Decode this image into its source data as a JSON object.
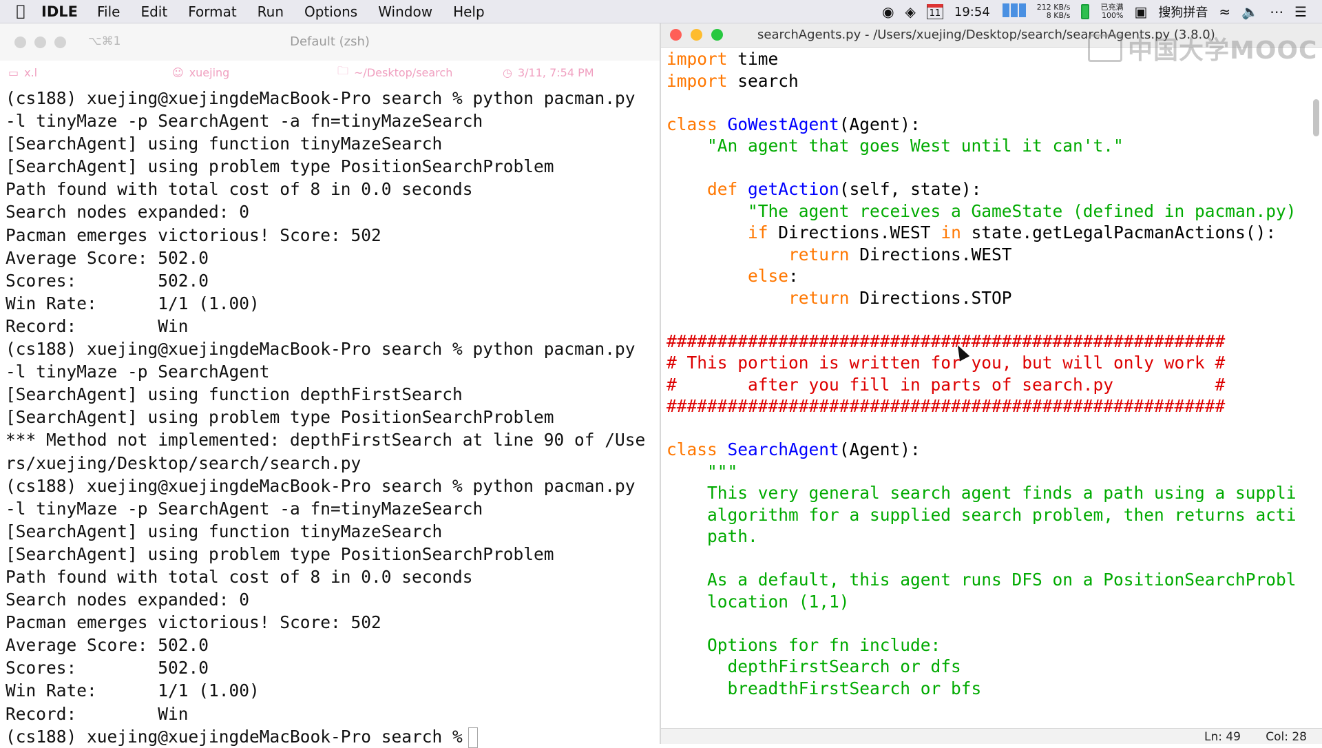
{
  "menubar": {
    "app_name": "IDLE",
    "menus": [
      "File",
      "Edit",
      "Format",
      "Run",
      "Options",
      "Window",
      "Help"
    ],
    "date_badge": "11",
    "clock": "19:54",
    "net_up": "212 KB/s",
    "net_down": "8 KB/s",
    "battery_status": "已充满",
    "battery_percent": "100%",
    "input_method": "搜狗拼音",
    "icons": [
      "apple-icon",
      "app-icon-1",
      "app-icon-2",
      "calendar-icon",
      "cpu-icon",
      "battery-icon",
      "sogou-icon",
      "wifi-icon",
      "volume-icon",
      "more-icon",
      "list-icon"
    ]
  },
  "terminal": {
    "shortcut": "⌥⌘1",
    "title": "Default (zsh)",
    "info": {
      "shell": "x.l",
      "user": "xuejing",
      "path": "~/Desktop/search",
      "time": "3/11, 7:54 PM"
    },
    "lines": [
      "(cs188) xuejing@xuejingdeMacBook-Pro search % python pacman.py",
      "-l tinyMaze -p SearchAgent -a fn=tinyMazeSearch",
      "[SearchAgent] using function tinyMazeSearch",
      "[SearchAgent] using problem type PositionSearchProblem",
      "Path found with total cost of 8 in 0.0 seconds",
      "Search nodes expanded: 0",
      "Pacman emerges victorious! Score: 502",
      "Average Score: 502.0",
      "Scores:        502.0",
      "Win Rate:      1/1 (1.00)",
      "Record:        Win",
      "(cs188) xuejing@xuejingdeMacBook-Pro search % python pacman.py",
      "-l tinyMaze -p SearchAgent",
      "[SearchAgent] using function depthFirstSearch",
      "[SearchAgent] using problem type PositionSearchProblem",
      "*** Method not implemented: depthFirstSearch at line 90 of /Use",
      "rs/xuejing/Desktop/search/search.py",
      "(cs188) xuejing@xuejingdeMacBook-Pro search % python pacman.py",
      "-l tinyMaze -p SearchAgent -a fn=tinyMazeSearch",
      "[SearchAgent] using function tinyMazeSearch",
      "[SearchAgent] using problem type PositionSearchProblem",
      "Path found with total cost of 8 in 0.0 seconds",
      "Search nodes expanded: 0",
      "Pacman emerges victorious! Score: 502",
      "Average Score: 502.0",
      "Scores:        502.0",
      "Win Rate:      1/1 (1.00)",
      "Record:        Win"
    ],
    "prompt": "(cs188) xuejing@xuejingdeMacBook-Pro search %"
  },
  "editor": {
    "title": "searchAgents.py - /Users/xuejing/Desktop/search/searchAgents.py (3.8.0)",
    "code_lines": [
      [
        [
          "kw",
          "import"
        ],
        [
          "",
          "time"
        ]
      ],
      [
        [
          "kw",
          "import"
        ],
        [
          "",
          "search"
        ]
      ],
      [],
      [
        [
          "kw",
          "class"
        ],
        [
          "df",
          "GoWestAgent"
        ],
        [
          "",
          "(Agent):"
        ]
      ],
      [
        [
          "",
          "    "
        ],
        [
          "st",
          "\"An agent that goes West until it can't.\""
        ]
      ],
      [],
      [
        [
          "",
          "    "
        ],
        [
          "kw",
          "def"
        ],
        [
          "df",
          "getAction"
        ],
        [
          "",
          "(self, state):"
        ]
      ],
      [
        [
          "",
          "        "
        ],
        [
          "st",
          "\"The agent receives a GameState (defined in pacman.py)"
        ]
      ],
      [
        [
          "",
          "        "
        ],
        [
          "kw",
          "if"
        ],
        [
          "",
          "Directions.WEST "
        ],
        [
          "kw",
          "in"
        ],
        [
          "",
          "state.getLegalPacmanActions():"
        ]
      ],
      [
        [
          "",
          "            "
        ],
        [
          "kw",
          "return"
        ],
        [
          "",
          "Directions.WEST"
        ]
      ],
      [
        [
          "",
          "        "
        ],
        [
          "kw",
          "else"
        ],
        [
          "",
          ":"
        ]
      ],
      [
        [
          "",
          "            "
        ],
        [
          "kw",
          "return"
        ],
        [
          "",
          "Directions.STOP"
        ]
      ],
      [],
      [
        [
          "cm",
          "#######################################################"
        ]
      ],
      [
        [
          "cm",
          "# This portion is written for you, but will only work #"
        ]
      ],
      [
        [
          "cm",
          "#       after you fill in parts of search.py          #"
        ]
      ],
      [
        [
          "cm",
          "#######################################################"
        ]
      ],
      [],
      [
        [
          "kw",
          "class"
        ],
        [
          "df",
          "SearchAgent"
        ],
        [
          "",
          "(Agent):"
        ]
      ],
      [
        [
          "",
          "    "
        ],
        [
          "st",
          "\"\"\""
        ]
      ],
      [
        [
          "",
          "    "
        ],
        [
          "st",
          "This very general search agent finds a path using a suppli"
        ]
      ],
      [
        [
          "",
          "    "
        ],
        [
          "st",
          "algorithm for a supplied search problem, then returns acti"
        ]
      ],
      [
        [
          "",
          "    "
        ],
        [
          "st",
          "path."
        ]
      ],
      [],
      [
        [
          "",
          "    "
        ],
        [
          "st",
          "As a default, this agent runs DFS on a PositionSearchProbl"
        ]
      ],
      [
        [
          "",
          "    "
        ],
        [
          "st",
          "location (1,1)"
        ]
      ],
      [],
      [
        [
          "",
          "    "
        ],
        [
          "st",
          "Options for fn include:"
        ]
      ],
      [
        [
          "",
          "      "
        ],
        [
          "st",
          "depthFirstSearch or dfs"
        ]
      ],
      [
        [
          "",
          "      "
        ],
        [
          "st",
          "breadthFirstSearch or bfs"
        ]
      ]
    ],
    "status": {
      "ln": "Ln: 49",
      "col": "Col: 28"
    }
  },
  "watermark": {
    "text": "中国大学MOOC"
  }
}
